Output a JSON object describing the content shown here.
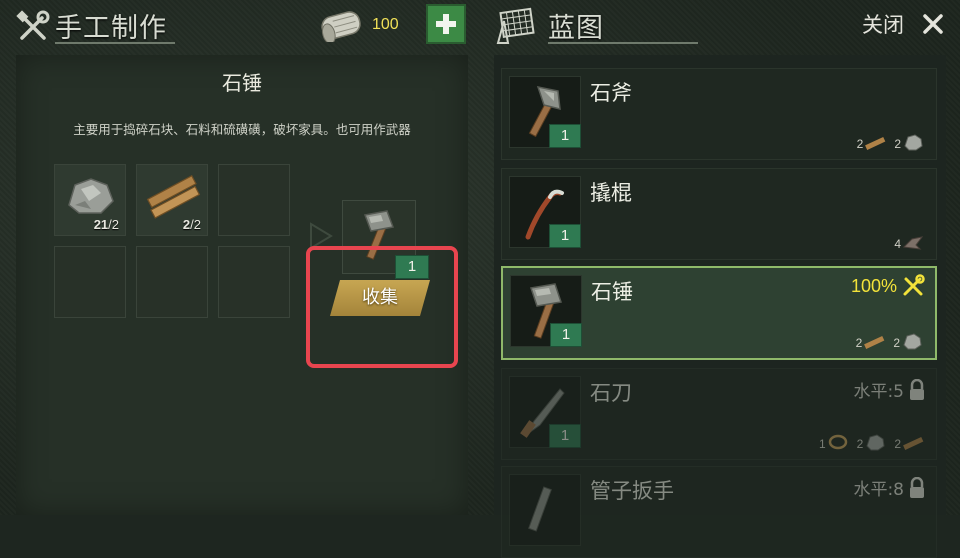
{
  "crafting": {
    "title": "手工制作",
    "currency": "100",
    "item_name": "石锤",
    "item_desc": "主要用于捣碎石块、石料和硫磺磺，破坏家具。也可用作武器",
    "slots": [
      {
        "icon": "stone-icon",
        "have": "21",
        "need": "/2"
      },
      {
        "icon": "plank-icon",
        "have": "2",
        "need": "/2"
      }
    ],
    "result_qty": "1",
    "collect_label": "收集"
  },
  "blueprints": {
    "title": "蓝图",
    "close_label": "关闭",
    "items": [
      {
        "name": "石斧",
        "qty": "1",
        "mats": [
          {
            "count": "2",
            "icon": "plank-icon"
          },
          {
            "count": "2",
            "icon": "stone-icon"
          }
        ]
      },
      {
        "name": "撬棍",
        "qty": "1",
        "mats": [
          {
            "count": "4",
            "icon": "metal-scrap-icon"
          }
        ]
      },
      {
        "name": "石锤",
        "qty": "1",
        "status": "100%",
        "mats": [
          {
            "count": "2",
            "icon": "plank-icon"
          },
          {
            "count": "2",
            "icon": "stone-icon"
          }
        ]
      },
      {
        "name": "石刀",
        "qty": "1",
        "level": "水平:5",
        "mats": [
          {
            "count": "1",
            "icon": "rope-icon"
          },
          {
            "count": "2",
            "icon": "stone-icon"
          },
          {
            "count": "2",
            "icon": "plank-icon"
          }
        ]
      },
      {
        "name": "管子扳手",
        "level": "水平:8"
      }
    ]
  },
  "colors": {
    "accent_green": "#3c8a45",
    "highlight_red": "#e8454f",
    "selected_border": "#8fb96a",
    "status_yellow": "#f2e23a"
  }
}
